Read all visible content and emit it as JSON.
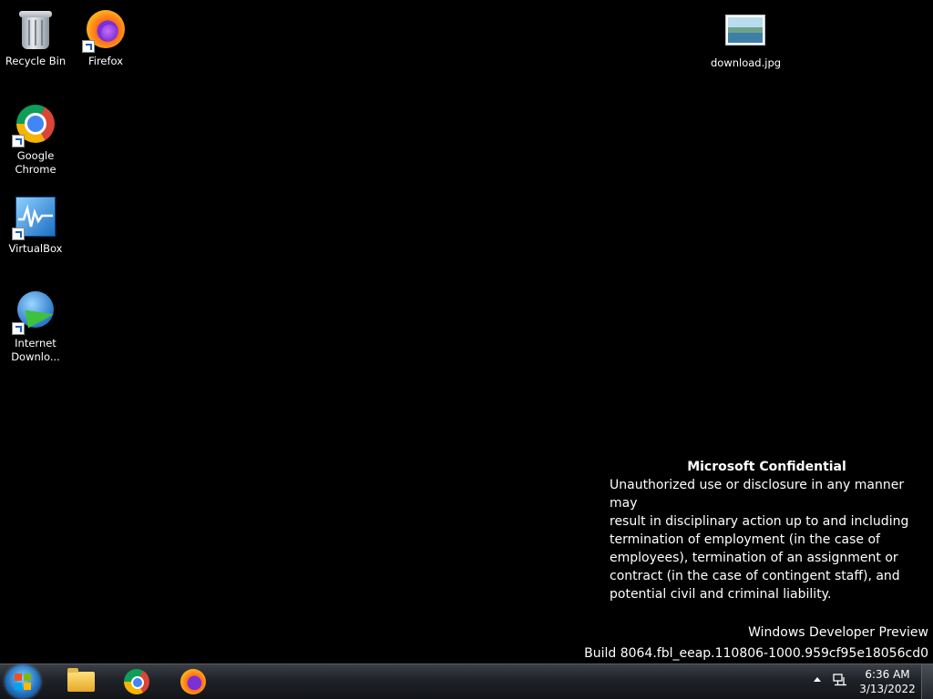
{
  "desktop": {
    "icons": [
      {
        "label": "Recycle Bin",
        "icon": "recycle-bin-icon"
      },
      {
        "label": "Firefox",
        "icon": "firefox-icon"
      },
      {
        "label": "Google Chrome",
        "icon": "chrome-icon"
      },
      {
        "label": "VirtualBox",
        "icon": "virtualbox-icon"
      },
      {
        "label": "Internet Downlo...",
        "icon": "internet-download-manager-icon"
      },
      {
        "label": "download.jpg",
        "icon": "image-file-icon"
      }
    ]
  },
  "watermark": {
    "title": "Microsoft Confidential",
    "lines": [
      "Unauthorized use or disclosure in any manner may",
      "result in disciplinary action up to and including",
      "termination of employment (in the case of",
      "employees), termination of an assignment or",
      "contract (in the case of contingent staff), and",
      "potential civil and criminal liability."
    ],
    "edition": "Windows Developer Preview",
    "build": "Build 8064.fbl_eeap.110806-1000.959cf95e18056cd0"
  },
  "taskbar": {
    "start_icon": "windows-start-icon",
    "pinned": [
      {
        "icon": "file-explorer-icon"
      },
      {
        "icon": "chrome-icon"
      },
      {
        "icon": "firefox-icon"
      }
    ],
    "tray": {
      "time": "6:36 AM",
      "date": "3/13/2022"
    }
  },
  "colors": {
    "desktop_background": "#000000",
    "text": "#ffffff"
  }
}
